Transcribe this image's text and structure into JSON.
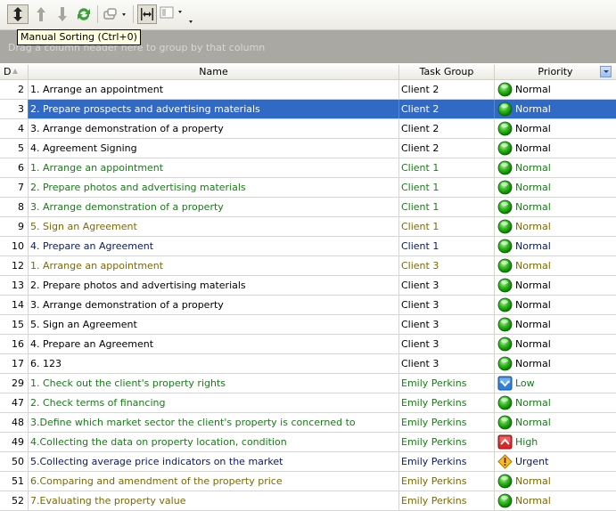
{
  "toolbar": {
    "buttons": [
      {
        "name": "manual-sorting-button",
        "icon": "manual-sort-icon"
      },
      {
        "name": "move-up-button",
        "icon": "arrow-up-icon"
      },
      {
        "name": "move-down-button",
        "icon": "arrow-down-icon"
      },
      {
        "name": "refresh-button",
        "icon": "refresh-icon"
      },
      {
        "name": "group-dropdown-button",
        "icon": "group-icon"
      },
      {
        "name": "best-fit-button",
        "icon": "best-fit-icon"
      },
      {
        "name": "layout-dropdown-button",
        "icon": "layout-icon"
      }
    ],
    "tooltip": "Manual Sorting (Ctrl+0)"
  },
  "grouping": {
    "hint": "Drag a column header here to group by that column"
  },
  "columns": {
    "id": "D",
    "name": "Name",
    "group": "Task Group",
    "priority": "Priority"
  },
  "colors": {
    "selected": "#316ac5",
    "green": "#1a7a1a",
    "olive": "#7a6a00",
    "dark": "#000000",
    "navy": "#0a1a5a"
  },
  "rows": [
    {
      "id": "2",
      "name": "1. Arrange an appointment",
      "group": "Client 2",
      "priority": "Normal",
      "color": "dark",
      "icon": "normal"
    },
    {
      "id": "3",
      "name": "2. Prepare prospects and advertising materials",
      "group": "Client 2",
      "priority": "Normal",
      "color": "dark",
      "icon": "normal",
      "selected": true
    },
    {
      "id": "4",
      "name": "3. Arrange demonstration of a property",
      "group": "Client 2",
      "priority": "Normal",
      "color": "dark",
      "icon": "normal"
    },
    {
      "id": "5",
      "name": "4. Agreement Signing",
      "group": "Client 2",
      "priority": "Normal",
      "color": "dark",
      "icon": "normal"
    },
    {
      "id": "6",
      "name": "1. Arrange an appointment",
      "group": "Client 1",
      "priority": "Normal",
      "color": "green",
      "icon": "normal"
    },
    {
      "id": "7",
      "name": "2. Prepare photos and advertising materials",
      "group": "Client 1",
      "priority": "Normal",
      "color": "green",
      "icon": "normal"
    },
    {
      "id": "8",
      "name": "3. Arrange demonstration of a property",
      "group": "Client 1",
      "priority": "Normal",
      "color": "green",
      "icon": "normal"
    },
    {
      "id": "9",
      "name": "5. Sign an Agreement",
      "group": "Client 1",
      "priority": "Normal",
      "color": "olive",
      "icon": "normal"
    },
    {
      "id": "10",
      "name": "4. Prepare an Agreement",
      "group": "Client 1",
      "priority": "Normal",
      "color": "navy",
      "icon": "normal"
    },
    {
      "id": "12",
      "name": "1. Arrange an appointment",
      "group": "Client 3",
      "priority": "Normal",
      "color": "olive",
      "icon": "normal"
    },
    {
      "id": "13",
      "name": "2. Prepare photos and advertising materials",
      "group": "Client 3",
      "priority": "Normal",
      "color": "dark",
      "icon": "normal"
    },
    {
      "id": "14",
      "name": "3. Arrange demonstration of a property",
      "group": "Client 3",
      "priority": "Normal",
      "color": "dark",
      "icon": "normal"
    },
    {
      "id": "15",
      "name": "5. Sign an Agreement",
      "group": "Client 3",
      "priority": "Normal",
      "color": "dark",
      "icon": "normal"
    },
    {
      "id": "16",
      "name": "4. Prepare an Agreement",
      "group": "Client 3",
      "priority": "Normal",
      "color": "dark",
      "icon": "normal"
    },
    {
      "id": "17",
      "name": "6. 123",
      "group": "Client 3",
      "priority": "Normal",
      "color": "dark",
      "icon": "normal"
    },
    {
      "id": "29",
      "name": "1. Check out the client's property rights",
      "group": "Emily Perkins",
      "priority": "Low",
      "color": "green",
      "icon": "low"
    },
    {
      "id": "47",
      "name": "2. Check terms of financing",
      "group": "Emily Perkins",
      "priority": "Normal",
      "color": "green",
      "icon": "normal"
    },
    {
      "id": "48",
      "name": "3.Define which market sector the client's property is concerned to",
      "group": "Emily Perkins",
      "priority": "Normal",
      "color": "green",
      "icon": "normal"
    },
    {
      "id": "49",
      "name": "4.Collecting the data on property location, condition",
      "group": "Emily Perkins",
      "priority": "High",
      "color": "green",
      "icon": "high"
    },
    {
      "id": "50",
      "name": "5.Collecting average price indicators on the market",
      "group": "Emily Perkins",
      "priority": "Urgent",
      "color": "navy",
      "icon": "urgent"
    },
    {
      "id": "51",
      "name": "6.Comparing and amendment of the property price",
      "group": "Emily Perkins",
      "priority": "Normal",
      "color": "olive",
      "icon": "normal"
    },
    {
      "id": "52",
      "name": "7.Evaluating the property value",
      "group": "Emily Perkins",
      "priority": "Normal",
      "color": "olive",
      "icon": "normal"
    }
  ]
}
